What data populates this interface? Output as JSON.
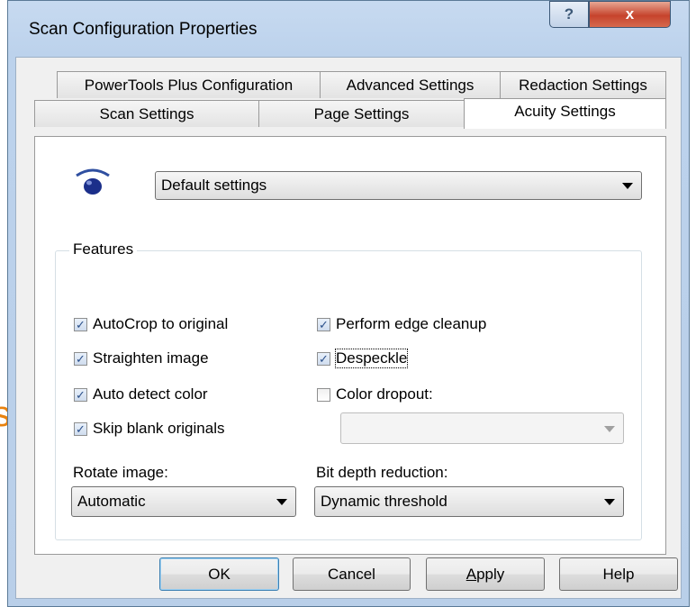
{
  "background_fragment": "s",
  "window": {
    "title": "Scan Configuration Properties",
    "help_glyph": "?",
    "close_glyph": "x"
  },
  "tabs": {
    "row_back": [
      {
        "label": "PowerTools Plus Configuration"
      },
      {
        "label": "Advanced Settings"
      },
      {
        "label": "Redaction Settings"
      }
    ],
    "row_front": [
      {
        "label": "Scan Settings"
      },
      {
        "label": "Page Settings"
      },
      {
        "label": "Acuity Settings",
        "active": true
      }
    ]
  },
  "acuity": {
    "icon": "eye-icon",
    "profile_select": {
      "value": "Default settings"
    },
    "features_group": {
      "label": "Features",
      "left_checks": [
        {
          "label": "AutoCrop to original",
          "checked": true
        },
        {
          "label": "Straighten image",
          "checked": true
        },
        {
          "label": "Auto detect color",
          "checked": true
        },
        {
          "label": "Skip blank originals",
          "checked": true
        }
      ],
      "right_checks": [
        {
          "label": "Perform edge cleanup",
          "checked": true
        },
        {
          "label": "Despeckle",
          "checked": true,
          "focused": true
        },
        {
          "label": "Color dropout:",
          "checked": false
        }
      ],
      "color_dropout_select": {
        "value": "",
        "disabled": true
      },
      "rotate_label": "Rotate image:",
      "rotate_select": {
        "value": "Automatic"
      },
      "bitdepth_label": "Bit depth reduction:",
      "bitdepth_select": {
        "value": "Dynamic threshold"
      }
    }
  },
  "buttons": {
    "ok": "OK",
    "cancel": "Cancel",
    "apply_mnemonic": "A",
    "apply_rest": "pply",
    "help": "Help"
  },
  "colors": {
    "accent_fragment": "#e8820e",
    "close_button": "#c6432c",
    "check_mark": "#2a4f8a"
  }
}
